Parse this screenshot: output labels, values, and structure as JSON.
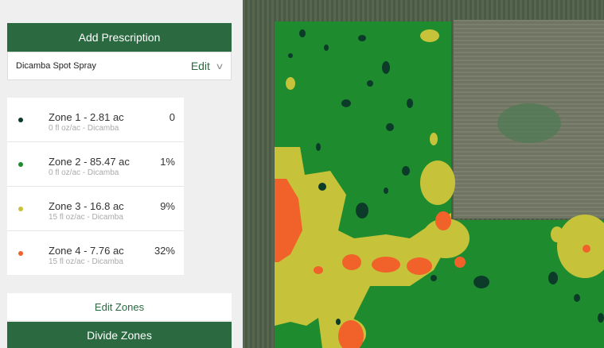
{
  "sidebar": {
    "add_prescription_label": "Add Prescription",
    "prescription": {
      "name": "Dicamba Spot Spray",
      "edit_label": "Edit"
    },
    "zones": [
      {
        "title": "Zone 1 - 2.81 ac",
        "subtitle": "0 fl oz/ac - Dicamba",
        "percent": "0",
        "color": "#0d3b29"
      },
      {
        "title": "Zone 2 - 85.47 ac",
        "subtitle": "0 fl oz/ac - Dicamba",
        "percent": "1%",
        "color": "#1e8c2e"
      },
      {
        "title": "Zone 3 - 16.8 ac",
        "subtitle": "15 fl oz/ac - Dicamba",
        "percent": "9%",
        "color": "#c6c33b"
      },
      {
        "title": "Zone 4 - 7.76 ac",
        "subtitle": "15 fl oz/ac - Dicamba",
        "percent": "32%",
        "color": "#f0622a"
      }
    ],
    "edit_zones_label": "Edit Zones",
    "divide_zones_label": "Divide Zones"
  },
  "colors": {
    "brand": "#2b6a41",
    "zone_dark": "#0d3b29",
    "zone_green": "#1e8c2e",
    "zone_yellow": "#c6c33b",
    "zone_orange": "#f0622a"
  }
}
